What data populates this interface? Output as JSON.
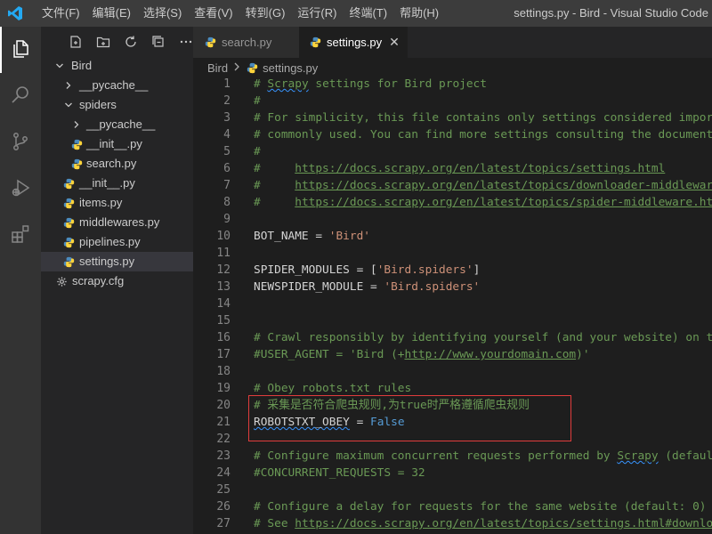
{
  "titlebar": {
    "menu": [
      "文件(F)",
      "编辑(E)",
      "选择(S)",
      "查看(V)",
      "转到(G)",
      "运行(R)",
      "终端(T)",
      "帮助(H)"
    ],
    "window_title": "settings.py - Bird - Visual Studio Code"
  },
  "explorer": {
    "root": "Bird",
    "items": [
      {
        "label": "__pycache__",
        "type": "folder",
        "depth": 1,
        "collapsed": true
      },
      {
        "label": "spiders",
        "type": "folder",
        "depth": 1,
        "collapsed": false
      },
      {
        "label": "__pycache__",
        "type": "folder",
        "depth": 2,
        "collapsed": true
      },
      {
        "label": "__init__.py",
        "type": "python",
        "depth": 2
      },
      {
        "label": "search.py",
        "type": "python",
        "depth": 2
      },
      {
        "label": "__init__.py",
        "type": "python",
        "depth": 1
      },
      {
        "label": "items.py",
        "type": "python",
        "depth": 1
      },
      {
        "label": "middlewares.py",
        "type": "python",
        "depth": 1
      },
      {
        "label": "pipelines.py",
        "type": "python",
        "depth": 1
      },
      {
        "label": "settings.py",
        "type": "python",
        "depth": 1,
        "selected": true
      },
      {
        "label": "scrapy.cfg",
        "type": "config",
        "depth": 0
      }
    ]
  },
  "tabs": [
    {
      "label": "search.py",
      "active": false
    },
    {
      "label": "settings.py",
      "active": true
    }
  ],
  "breadcrumb": [
    "Bird",
    "settings.py"
  ],
  "code_lines": [
    {
      "n": "1",
      "text": "# Scrapy settings for Bird project"
    },
    {
      "n": "2",
      "text": "#"
    },
    {
      "n": "3",
      "text": "# For simplicity, this file contains only settings considered impor"
    },
    {
      "n": "4",
      "text": "# commonly used. You can find more settings consulting the document"
    },
    {
      "n": "5",
      "text": "#"
    },
    {
      "n": "6",
      "text": "#     https://docs.scrapy.org/en/latest/topics/settings.html"
    },
    {
      "n": "7",
      "text": "#     https://docs.scrapy.org/en/latest/topics/downloader-middlewar"
    },
    {
      "n": "8",
      "text": "#     https://docs.scrapy.org/en/latest/topics/spider-middleware.ht"
    },
    {
      "n": "9",
      "text": ""
    },
    {
      "n": "10",
      "text": "BOT_NAME = 'Bird'"
    },
    {
      "n": "11",
      "text": ""
    },
    {
      "n": "12",
      "text": "SPIDER_MODULES = ['Bird.spiders']"
    },
    {
      "n": "13",
      "text": "NEWSPIDER_MODULE = 'Bird.spiders'"
    },
    {
      "n": "14",
      "text": ""
    },
    {
      "n": "15",
      "text": ""
    },
    {
      "n": "16",
      "text": "# Crawl responsibly by identifying yourself (and your website) on t"
    },
    {
      "n": "17",
      "text": "#USER_AGENT = 'Bird (+http://www.yourdomain.com)'"
    },
    {
      "n": "18",
      "text": ""
    },
    {
      "n": "19",
      "text": "# Obey robots.txt rules"
    },
    {
      "n": "20",
      "text": "# 采集是否符合爬虫规则,为true时严格遵循爬虫规则"
    },
    {
      "n": "21",
      "text": "ROBOTSTXT_OBEY = False"
    },
    {
      "n": "22",
      "text": ""
    },
    {
      "n": "23",
      "text": "# Configure maximum concurrent requests performed by Scrapy (defaul"
    },
    {
      "n": "24",
      "text": "#CONCURRENT_REQUESTS = 32"
    },
    {
      "n": "25",
      "text": ""
    },
    {
      "n": "26",
      "text": "# Configure a delay for requests for the same website (default: 0)"
    },
    {
      "n": "27",
      "text": "# See https://docs.scrapy.org/en/latest/topics/settings.html#downlo"
    }
  ],
  "colors": {
    "comment": "#6a9955",
    "string": "#ce9178",
    "keyword": "#569cd6",
    "highlight_box": "#e03c3c"
  }
}
